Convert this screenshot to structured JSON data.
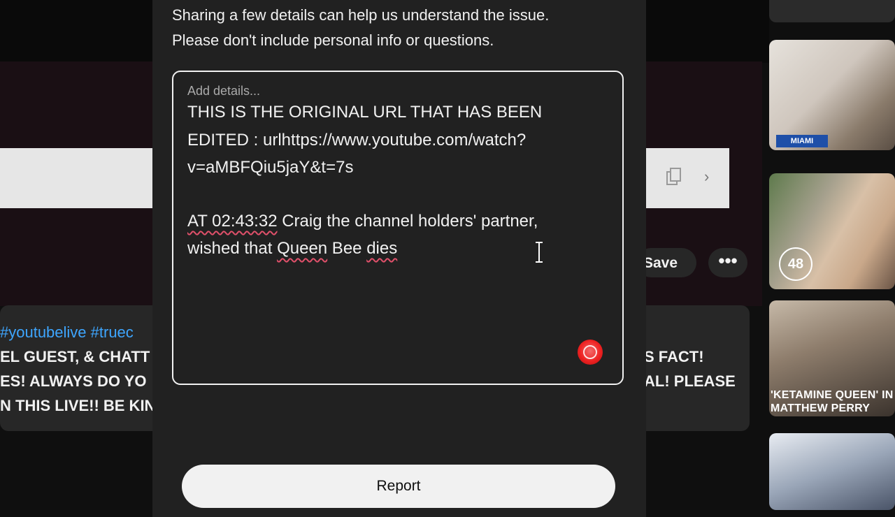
{
  "modal": {
    "hint_line1": "Sharing a few details can help us understand the issue.",
    "hint_line2": "Please don't include personal info or questions.",
    "placeholder": "Add details...",
    "text_lines": [
      "THIS IS THE ORIGINAL URL THAT HAS BEEN",
      "EDITED : urlhttps://www.youtube.com/watch?",
      "v=aMBFQiu5jaY&t=7s",
      "",
      " AT 02:43:32",
      " Craig the channel holders' partner,",
      "wished that ",
      "Queen",
      " Bee ",
      "dies"
    ],
    "report_label": "Report"
  },
  "background": {
    "action_save_label": "Save",
    "more_label": "•••",
    "description_lines": [
      "#youtubelive #truec",
      "EL GUEST, & CHATT",
      "ES!  ALWAYS DO YO",
      "N THIS LIVE!!  BE KIN"
    ],
    "description_right": [
      "S FACT!",
      "AL!  PLEASE"
    ]
  },
  "sidebar": {
    "thumb1_badge": "MIAMI",
    "thumb2_badge": "48",
    "thumb3_caption": "'KETAMINE QUEEN' IN MATTHEW PERRY"
  },
  "colors": {
    "modal_bg": "#212121",
    "page_bg": "#0f0f0f",
    "spell_underline": "#e0506a",
    "record_red": "#e22222"
  }
}
